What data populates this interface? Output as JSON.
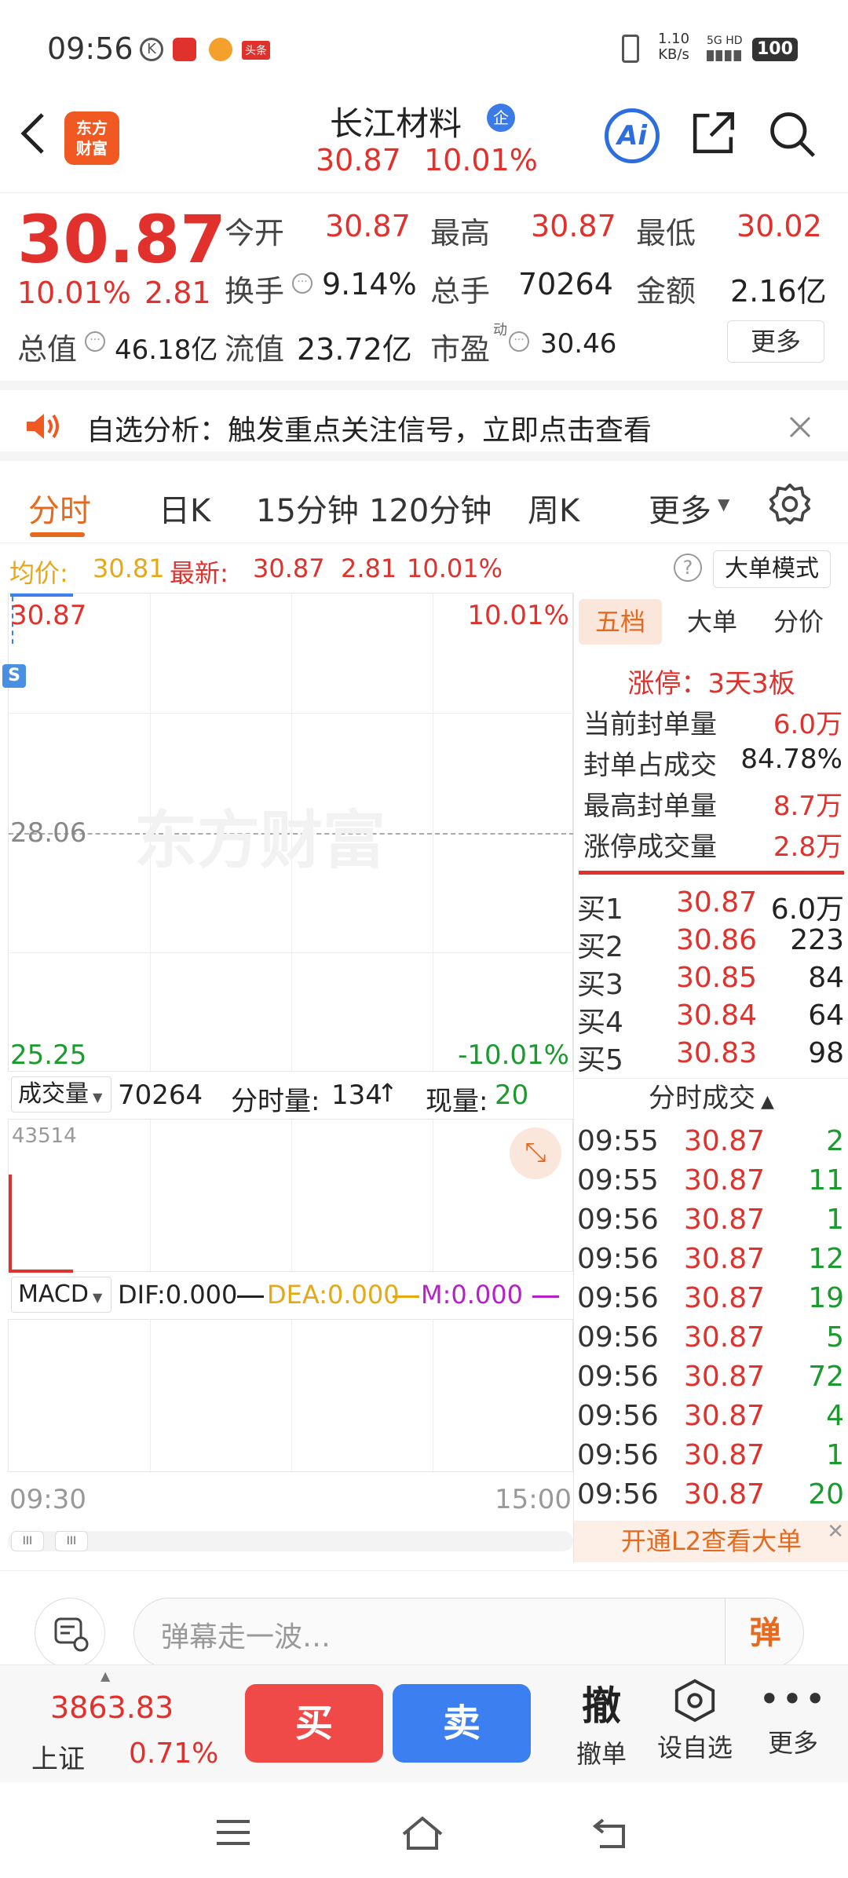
{
  "status_bar": {
    "time": "09:56",
    "net_speed": "1.10",
    "net_unit": "KB/s",
    "network": "5G HD",
    "battery": "100",
    "news_badge": "头条"
  },
  "header": {
    "stock_name": "长江材料",
    "badge": "企",
    "price": "30.87",
    "change_pct": "10.01%",
    "ai_label": "Ai",
    "logo_line1": "东方",
    "logo_line2": "财富"
  },
  "quote": {
    "price": "30.87",
    "change_pct": "10.01%",
    "change": "2.81",
    "open_label": "今开",
    "open": "30.87",
    "high_label": "最高",
    "high": "30.87",
    "low_label": "最低",
    "low": "30.02",
    "turnover_label": "换手",
    "turnover": "9.14%",
    "volume_label": "总手",
    "volume": "70264",
    "amount_label": "金额",
    "amount": "2.16亿",
    "mcap_label": "总值",
    "mcap": "46.18亿",
    "float_label": "流值",
    "float_cap": "23.72亿",
    "pe_label": "市盈",
    "pe_sup": "动",
    "pe": "30.46",
    "more": "更多"
  },
  "alert": {
    "text": "自选分析：触发重点关注信号，立即点击查看"
  },
  "tabs": [
    {
      "label": "分时",
      "active": true
    },
    {
      "label": "日K"
    },
    {
      "label": "15分钟"
    },
    {
      "label": "120分钟"
    },
    {
      "label": "周K"
    },
    {
      "label": "更多"
    }
  ],
  "info_line": {
    "avg_label": "均价:",
    "avg": "30.81",
    "latest_label": "最新:",
    "latest": "30.87",
    "change": "2.81",
    "change_pct": "10.01%",
    "big_mode": "大单模式"
  },
  "chart": {
    "top_price": "30.87",
    "top_pct": "10.01%",
    "mid_price": "28.06",
    "bottom_price": "25.25",
    "bottom_pct": "-10.01%",
    "watermark": "东方财富",
    "s_marker": "S",
    "start_time": "09:30",
    "end_time": "15:00"
  },
  "volume_panel": {
    "label": "成交量",
    "total": "70264",
    "tick_label": "分时量:",
    "tick": "134",
    "now_label": "现量:",
    "now": "20",
    "max": "43514"
  },
  "macd": {
    "label": "MACD",
    "dif": "DIF:0.000",
    "dea": "DEA:0.000",
    "m": "M:0.000"
  },
  "right_panel": {
    "tabs": [
      "五档",
      "大单",
      "分价"
    ],
    "limit_text": "涨停：3天3板",
    "stats": [
      {
        "label": "当前封单量",
        "value": "6.0万"
      },
      {
        "label": "封单占成交",
        "value": "84.78%"
      },
      {
        "label": "最高封单量",
        "value": "8.7万"
      },
      {
        "label": "涨停成交量",
        "value": "2.8万"
      }
    ],
    "bids": [
      {
        "label": "买1",
        "price": "30.87",
        "vol": "6.0万"
      },
      {
        "label": "买2",
        "price": "30.86",
        "vol": "223"
      },
      {
        "label": "买3",
        "price": "30.85",
        "vol": "84"
      },
      {
        "label": "买4",
        "price": "30.84",
        "vol": "64"
      },
      {
        "label": "买5",
        "price": "30.83",
        "vol": "98"
      }
    ],
    "trades_title": "分时成交",
    "trades": [
      {
        "time": "09:55",
        "price": "30.87",
        "vol": "2"
      },
      {
        "time": "09:55",
        "price": "30.87",
        "vol": "11"
      },
      {
        "time": "09:56",
        "price": "30.87",
        "vol": "1"
      },
      {
        "time": "09:56",
        "price": "30.87",
        "vol": "12"
      },
      {
        "time": "09:56",
        "price": "30.87",
        "vol": "19"
      },
      {
        "time": "09:56",
        "price": "30.87",
        "vol": "5"
      },
      {
        "time": "09:56",
        "price": "30.87",
        "vol": "72"
      },
      {
        "time": "09:56",
        "price": "30.87",
        "vol": "4"
      },
      {
        "time": "09:56",
        "price": "30.87",
        "vol": "1"
      },
      {
        "time": "09:56",
        "price": "30.87",
        "vol": "20"
      }
    ],
    "l2_banner": "开通L2查看大单"
  },
  "danmu": {
    "placeholder": "弹幕走一波…",
    "btn": "弹"
  },
  "toolbar": {
    "index_value": "3863.83",
    "index_name": "上证",
    "index_pct": "0.71%",
    "buy": "买",
    "sell": "卖",
    "cancel_icon": "撤",
    "cancel_label": "撤单",
    "watch_label": "设自选",
    "more_label": "更多"
  },
  "colors": {
    "up": "#e0312c",
    "down": "#1b9a2e",
    "accent": "#e56a1f",
    "buy_btn": "#ef4a48",
    "sell_btn": "#3c7ff0"
  }
}
